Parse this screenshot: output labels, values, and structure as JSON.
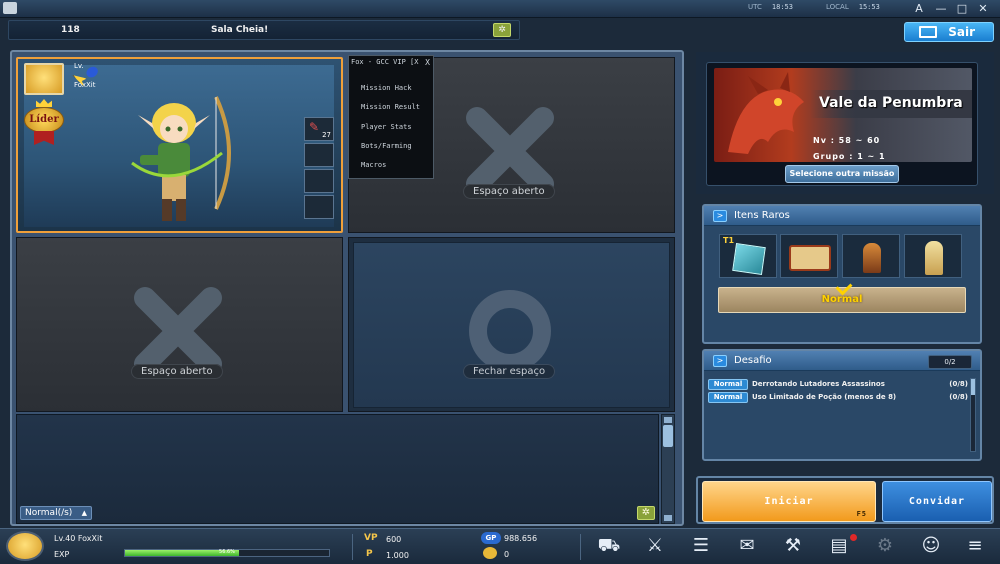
{
  "topbar": {
    "utc_label": "UTC",
    "utc_time": "18:53",
    "local_label": "LOCAL",
    "local_time": "15:53",
    "font_button": "A",
    "minimize": "—",
    "maximize": "□",
    "close": "✕"
  },
  "room": {
    "number": "118",
    "status": "Sala Cheia!",
    "exit_label": "Sair"
  },
  "slots": {
    "player": {
      "name": "FoxXit",
      "level_short": "Lv.",
      "leader_badge": "Líder",
      "item_count": "27"
    },
    "open_label_top": "Espaço aberto",
    "open_label_bottom": "Espaço aberto",
    "closed_label": "Fechar espaço"
  },
  "hack_menu": {
    "title": "Fox - GCC VIP [X",
    "close": "X",
    "items": [
      "Mission Hack",
      "Mission Result",
      "Player Stats",
      "Bots/Farming",
      "Macros"
    ]
  },
  "chat": {
    "mode": "Normal(/s)"
  },
  "mission": {
    "name": "Vale da Penumbra",
    "level": "Nv : 58 ~ 60",
    "group": "Grupo : 1 ~ 1",
    "select_button": "Selecione outra missão"
  },
  "rare_items": {
    "title": "Itens Raros",
    "tier_badge": "T1",
    "difficulty": "Normal"
  },
  "challenge": {
    "title": "Desafio",
    "count": "0/2",
    "rows": [
      {
        "badge": "Normal",
        "text": "Derrotando Lutadores Assassinos",
        "progress": "(0/8)"
      },
      {
        "badge": "Normal",
        "text": "Uso Limitado de Poção (menos de 8)",
        "progress": "(0/8)"
      }
    ]
  },
  "actions": {
    "start": "Iniciar",
    "start_key": "F5",
    "invite": "Convidar"
  },
  "bottom": {
    "player_label": "Lv.40 FoxXit",
    "exp_label": "EXP",
    "exp_fraction": 0.56,
    "exp_percent": "56.6%",
    "vp_label": "VP",
    "vp_value": "600",
    "p_label": "P",
    "p_value": "1.000",
    "gp_label": "GP",
    "gp_value": "988.656",
    "gem_value": "0"
  },
  "colors": {
    "leader_frame": "#f0a03a",
    "start_button": "#f29a1c",
    "invite_button": "#1a5fb0",
    "exit_button": "#1a7ed0"
  }
}
